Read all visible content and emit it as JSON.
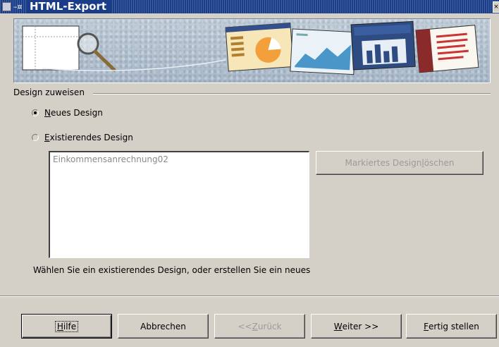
{
  "window": {
    "title": "HTML-Export",
    "title_icons": [
      "app-icon",
      "pin-icon"
    ]
  },
  "group": {
    "label": "Design zuweisen"
  },
  "options": {
    "new_design": {
      "label_accel": "N",
      "label_rest": "eues Design",
      "selected": true
    },
    "existing_design": {
      "label_accel": "E",
      "label_rest": "xistierendes Design",
      "selected": false
    }
  },
  "designs_list": {
    "items": [
      "Einkommensanrechnung02"
    ]
  },
  "delete_button": {
    "label_pre": "Markiertes Design ",
    "label_accel": "l",
    "label_post": "öschen",
    "enabled": false
  },
  "hint": "Wählen Sie ein existierendes Design, oder erstellen Sie ein neues",
  "buttons": {
    "help": {
      "accel": "H",
      "rest": "ilfe"
    },
    "cancel": {
      "label": "Abbrechen"
    },
    "back": {
      "pre": "<< ",
      "accel": "Z",
      "rest": "urück",
      "enabled": false
    },
    "next": {
      "accel": "W",
      "rest": "eiter >>"
    },
    "finish": {
      "accel": "F",
      "rest": "ertig stellen"
    }
  }
}
